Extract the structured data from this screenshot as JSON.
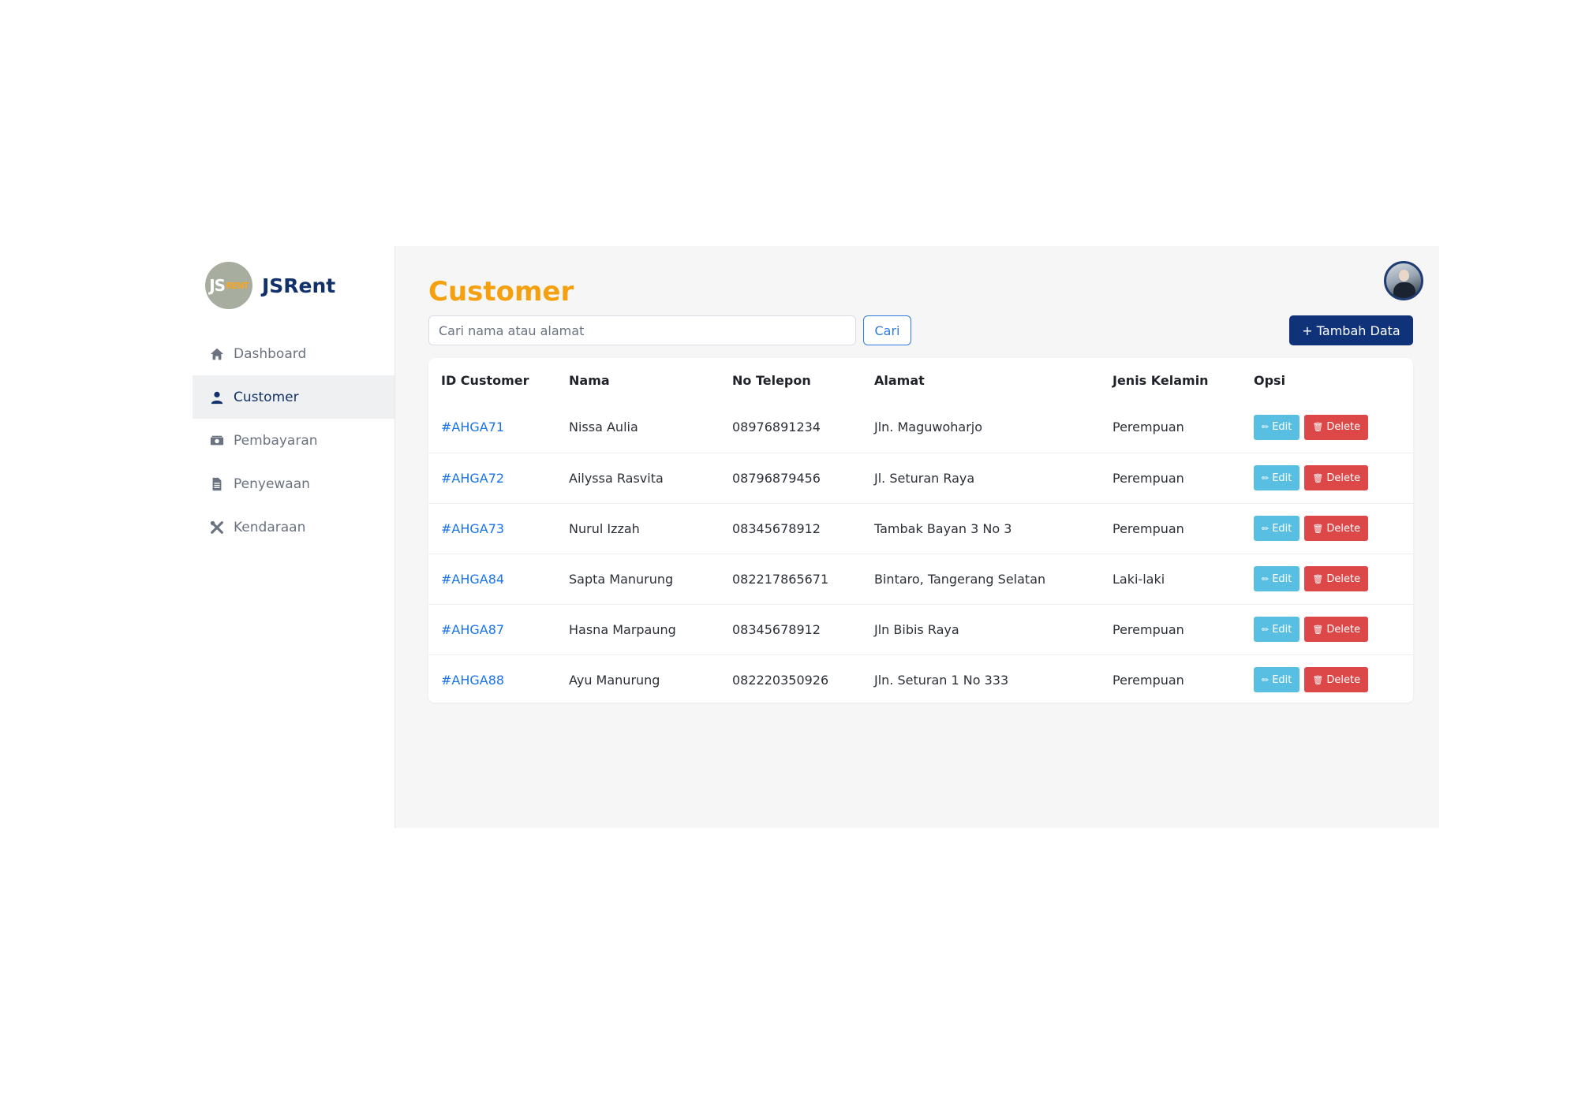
{
  "brand": {
    "name": "JSRent",
    "logo_main": "JS",
    "logo_sub": "RENT"
  },
  "sidebar": {
    "items": [
      {
        "label": "Dashboard",
        "icon": "home-icon"
      },
      {
        "label": "Customer",
        "icon": "user-icon",
        "active": true
      },
      {
        "label": "Pembayaran",
        "icon": "money-icon"
      },
      {
        "label": "Penyewaan",
        "icon": "document-icon"
      },
      {
        "label": "Kendaraan",
        "icon": "tools-icon"
      }
    ]
  },
  "main": {
    "title": "Customer",
    "search": {
      "placeholder": "Cari nama atau alamat",
      "value": "",
      "button_label": "Cari"
    },
    "add_button_label": "+ Tambah Data"
  },
  "table": {
    "columns": [
      "ID Customer",
      "Nama",
      "No Telepon",
      "Alamat",
      "Jenis Kelamin",
      "Opsi"
    ],
    "rows": [
      {
        "id": "#AHGA71",
        "nama": "Nissa Aulia",
        "telepon": "08976891234",
        "alamat": "Jln. Maguwoharjo",
        "kelamin": "Perempuan"
      },
      {
        "id": "#AHGA72",
        "nama": "Ailyssa Rasvita",
        "telepon": "08796879456",
        "alamat": "Jl. Seturan Raya",
        "kelamin": "Perempuan"
      },
      {
        "id": "#AHGA73",
        "nama": "Nurul Izzah",
        "telepon": "08345678912",
        "alamat": "Tambak Bayan 3 No 3",
        "kelamin": "Perempuan"
      },
      {
        "id": "#AHGA84",
        "nama": "Sapta Manurung",
        "telepon": "082217865671",
        "alamat": "Bintaro, Tangerang Selatan",
        "kelamin": "Laki-laki"
      },
      {
        "id": "#AHGA87",
        "nama": "Hasna Marpaung",
        "telepon": "08345678912",
        "alamat": "Jln Bibis Raya",
        "kelamin": "Perempuan"
      },
      {
        "id": "#AHGA88",
        "nama": "Ayu Manurung",
        "telepon": "082220350926",
        "alamat": "Jln. Seturan 1 No 333",
        "kelamin": "Perempuan"
      }
    ],
    "edit_label": "Edit",
    "delete_label": "Delete"
  },
  "colors": {
    "brand": "#12316b",
    "title": "#f5a10f",
    "link": "#1a73e8",
    "primary_button": "#0f3278",
    "edit_button": "#58bfe3",
    "delete_button": "#dc4848"
  }
}
